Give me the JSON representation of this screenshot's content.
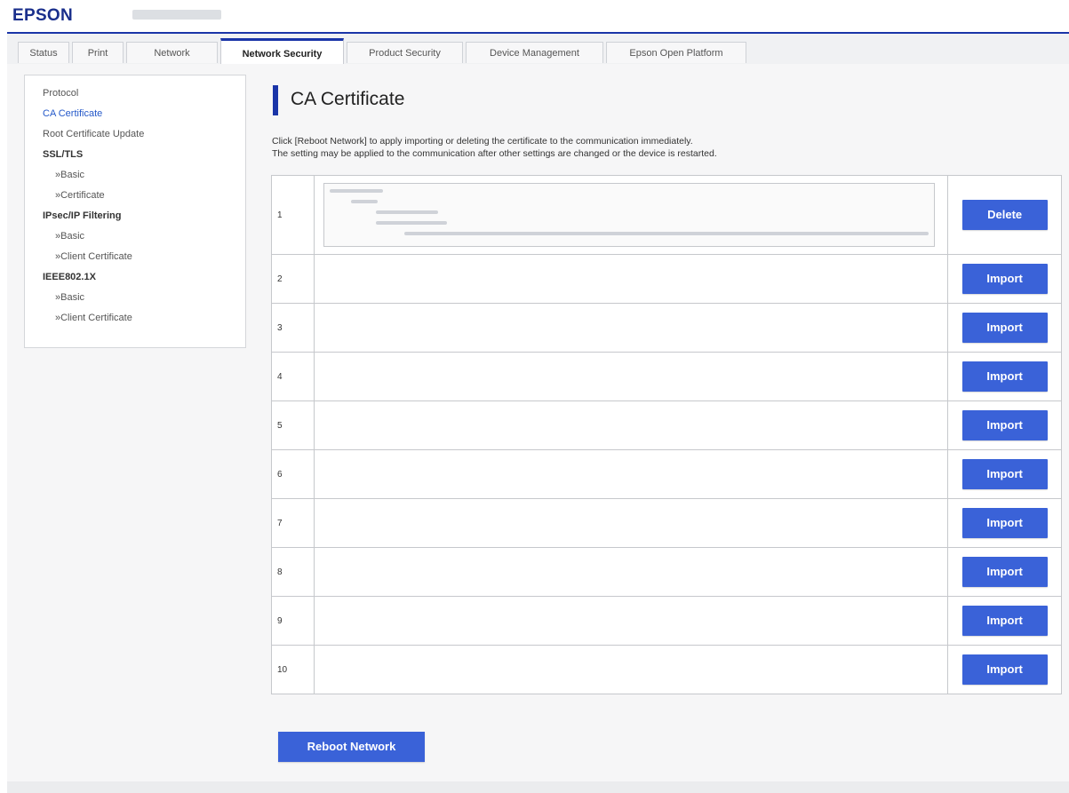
{
  "header": {
    "logo": "EPSON"
  },
  "tabs": [
    {
      "label": "Status",
      "active": false
    },
    {
      "label": "Print",
      "active": false
    },
    {
      "label": "Network",
      "active": false
    },
    {
      "label": "Network Security",
      "active": true
    },
    {
      "label": "Product Security",
      "active": false
    },
    {
      "label": "Device Management",
      "active": false
    },
    {
      "label": "Epson Open Platform",
      "active": false
    }
  ],
  "sidebar": {
    "protocol": "Protocol",
    "ca_certificate": "CA Certificate",
    "root_update": "Root Certificate Update",
    "ssl_tls": "SSL/TLS",
    "ssl_basic": "»Basic",
    "ssl_certificate": "»Certificate",
    "ipsec": "IPsec/IP Filtering",
    "ipsec_basic": "»Basic",
    "ipsec_client": "»Client Certificate",
    "ieee": "IEEE802.1X",
    "ieee_basic": "»Basic",
    "ieee_client": "»Client Certificate"
  },
  "page": {
    "title": "CA Certificate",
    "desc_line1": "Click [Reboot Network] to apply importing or deleting the certificate to the communication immediately.",
    "desc_line2": "The setting may be applied to the communication after other settings are changed or the device is restarted."
  },
  "rows": [
    {
      "num": "1",
      "action": "Delete"
    },
    {
      "num": "2",
      "action": "Import"
    },
    {
      "num": "3",
      "action": "Import"
    },
    {
      "num": "4",
      "action": "Import"
    },
    {
      "num": "5",
      "action": "Import"
    },
    {
      "num": "6",
      "action": "Import"
    },
    {
      "num": "7",
      "action": "Import"
    },
    {
      "num": "8",
      "action": "Import"
    },
    {
      "num": "9",
      "action": "Import"
    },
    {
      "num": "10",
      "action": "Import"
    }
  ],
  "reboot_label": "Reboot Network",
  "colors": {
    "accent": "#1a35a8",
    "button": "#3a62d8",
    "link": "#2458c9"
  }
}
